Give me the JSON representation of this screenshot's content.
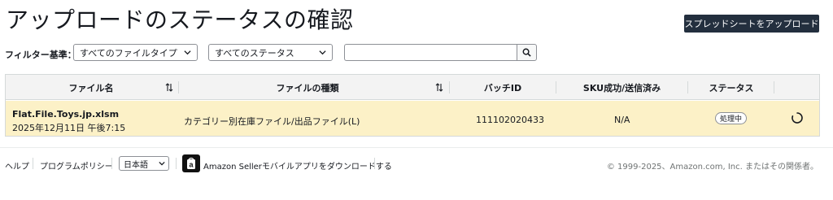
{
  "header": {
    "title": "アップロードのステータスの確認",
    "upload_button": "スプレッドシートをアップロード"
  },
  "filters": {
    "label": "フィルター基準：",
    "file_type_selected": "すべてのファイルタイプ",
    "status_selected": "すべてのステータス",
    "search_value": "",
    "icons": {
      "chevron": "chevron-down-icon",
      "search": "search-icon"
    }
  },
  "table": {
    "columns": [
      "ファイル名",
      "ファイルの種類",
      "バッチID",
      "SKU成功/送信済み",
      "ステータス"
    ],
    "rows": [
      {
        "file_name": "Flat.File.Toys.jp.xlsm",
        "date": "2025年12月11日 午後7:15",
        "file_kind": "カテゴリー別在庫ファイル/出品ファイル(L)",
        "batch_id": "111102020433",
        "sku": "N/A",
        "status": "処理中"
      }
    ],
    "row_highlight_color": "#fcf1c7"
  },
  "footer": {
    "help": "ヘルプ",
    "program_policy": "プログラムポリシー",
    "language": "日本語",
    "app_download": "Amazon Sellerモバイルアプリをダウンロードする",
    "copyright": "© 1999-2025、Amazon.com, Inc. またはその関係者。"
  },
  "colors": {
    "primary_button": "#232f3e",
    "header_bg": "#f3f3f3"
  }
}
